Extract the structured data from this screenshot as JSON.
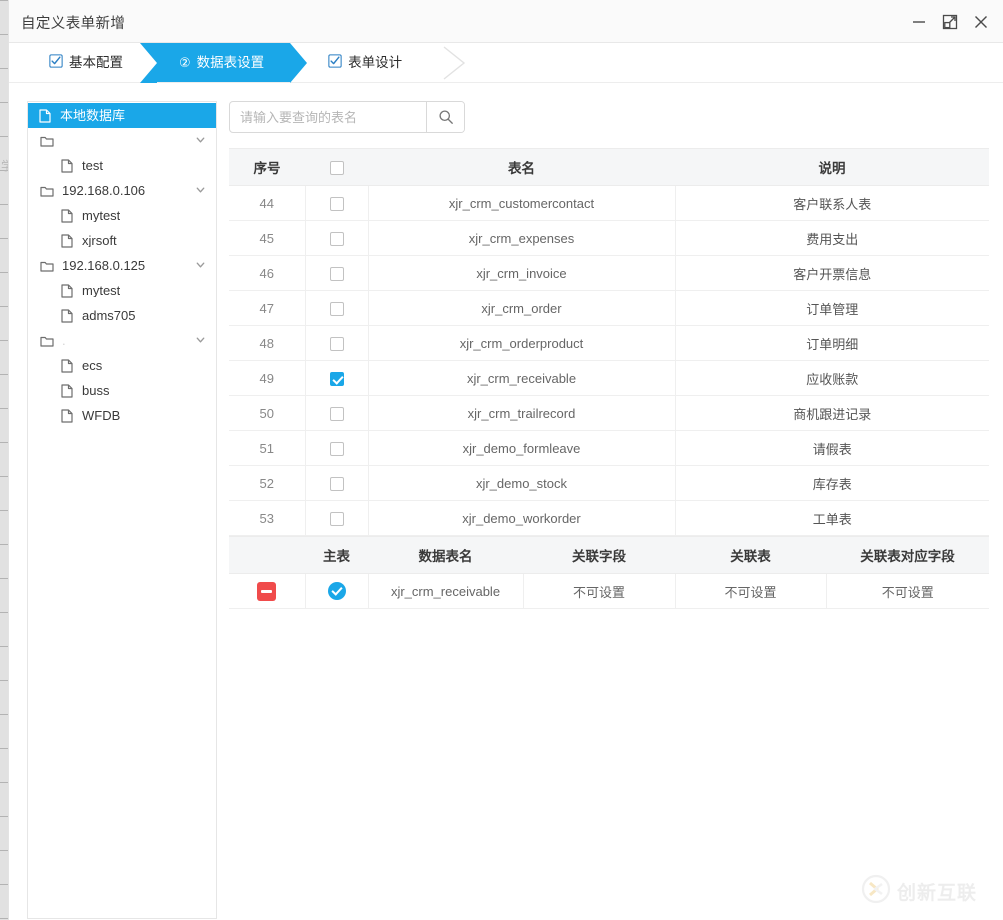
{
  "window": {
    "title": "自定义表单新增",
    "controls": {
      "minimize": "minimize-icon",
      "maximize": "maximize-icon",
      "close": "close-icon"
    }
  },
  "steps": [
    {
      "label": "基本配置",
      "state": "done",
      "marker": "checkbox-checked-icon",
      "number": ""
    },
    {
      "label": "数据表设置",
      "state": "active",
      "marker": "number",
      "number": "②"
    },
    {
      "label": "表单设计",
      "state": "done",
      "marker": "checkbox-checked-icon",
      "number": ""
    }
  ],
  "tree": {
    "nodes": [
      {
        "label": "本地数据库",
        "icon": "file-icon",
        "level": 0,
        "selected": true,
        "expandable": false,
        "faint": false
      },
      {
        "label": "",
        "icon": "folder-icon",
        "level": 1,
        "selected": false,
        "expandable": true,
        "faint": false
      },
      {
        "label": "test",
        "icon": "file-icon",
        "level": 2,
        "selected": false,
        "expandable": false,
        "faint": false
      },
      {
        "label": "192.168.0.106",
        "icon": "folder-icon",
        "level": 1,
        "selected": false,
        "expandable": true,
        "faint": false
      },
      {
        "label": "mytest",
        "icon": "file-icon",
        "level": 2,
        "selected": false,
        "expandable": false,
        "faint": false
      },
      {
        "label": "xjrsoft",
        "icon": "file-icon",
        "level": 2,
        "selected": false,
        "expandable": false,
        "faint": false
      },
      {
        "label": "192.168.0.125",
        "icon": "folder-icon",
        "level": 1,
        "selected": false,
        "expandable": true,
        "faint": false
      },
      {
        "label": "mytest",
        "icon": "file-icon",
        "level": 2,
        "selected": false,
        "expandable": false,
        "faint": false
      },
      {
        "label": "adms705",
        "icon": "file-icon",
        "level": 2,
        "selected": false,
        "expandable": false,
        "faint": false
      },
      {
        "label": ".",
        "icon": "folder-icon",
        "level": 1,
        "selected": false,
        "expandable": true,
        "faint": true
      },
      {
        "label": "ecs",
        "icon": "file-icon",
        "level": 2,
        "selected": false,
        "expandable": false,
        "faint": false
      },
      {
        "label": "buss",
        "icon": "file-icon",
        "level": 2,
        "selected": false,
        "expandable": false,
        "faint": false
      },
      {
        "label": "WFDB",
        "icon": "file-icon",
        "level": 2,
        "selected": false,
        "expandable": false,
        "faint": false
      }
    ]
  },
  "search": {
    "value": "",
    "placeholder": "请输入要查询的表名",
    "button_icon": "search-icon"
  },
  "tables_grid": {
    "headers": [
      "序号",
      "",
      "表名",
      "说明"
    ],
    "header_select_all_checked": false,
    "rows": [
      {
        "seq": "44",
        "checked": false,
        "name": "xjr_crm_customercontact",
        "desc": "客户联系人表"
      },
      {
        "seq": "45",
        "checked": false,
        "name": "xjr_crm_expenses",
        "desc": "费用支出"
      },
      {
        "seq": "46",
        "checked": false,
        "name": "xjr_crm_invoice",
        "desc": "客户开票信息"
      },
      {
        "seq": "47",
        "checked": false,
        "name": "xjr_crm_order",
        "desc": "订单管理"
      },
      {
        "seq": "48",
        "checked": false,
        "name": "xjr_crm_orderproduct",
        "desc": "订单明细"
      },
      {
        "seq": "49",
        "checked": true,
        "name": "xjr_crm_receivable",
        "desc": "应收账款"
      },
      {
        "seq": "50",
        "checked": false,
        "name": "xjr_crm_trailrecord",
        "desc": "商机跟进记录"
      },
      {
        "seq": "51",
        "checked": false,
        "name": "xjr_demo_formleave",
        "desc": "请假表"
      },
      {
        "seq": "52",
        "checked": false,
        "name": "xjr_demo_stock",
        "desc": "库存表"
      },
      {
        "seq": "53",
        "checked": false,
        "name": "xjr_demo_workorder",
        "desc": "工单表"
      }
    ]
  },
  "relation_grid": {
    "headers": [
      "",
      "主表",
      "数据表名",
      "关联字段",
      "关联表",
      "关联表对应字段"
    ],
    "rows": [
      {
        "delete_icon": "minus-button-icon",
        "is_main": true,
        "table_name": "xjr_crm_receivable",
        "relation_field": "不可设置",
        "relation_table": "不可设置",
        "relation_target_field": "不可设置"
      }
    ]
  },
  "watermark": {
    "text": "创新互联",
    "logo_icon": "brand-logo-icon"
  },
  "colors": {
    "accent": "#1aa7e8",
    "danger": "#f04b4b",
    "header_bg": "#f5f6f7",
    "border": "#e6e6e6",
    "text": "#3a3a3a",
    "muted": "#c6c6c6"
  }
}
